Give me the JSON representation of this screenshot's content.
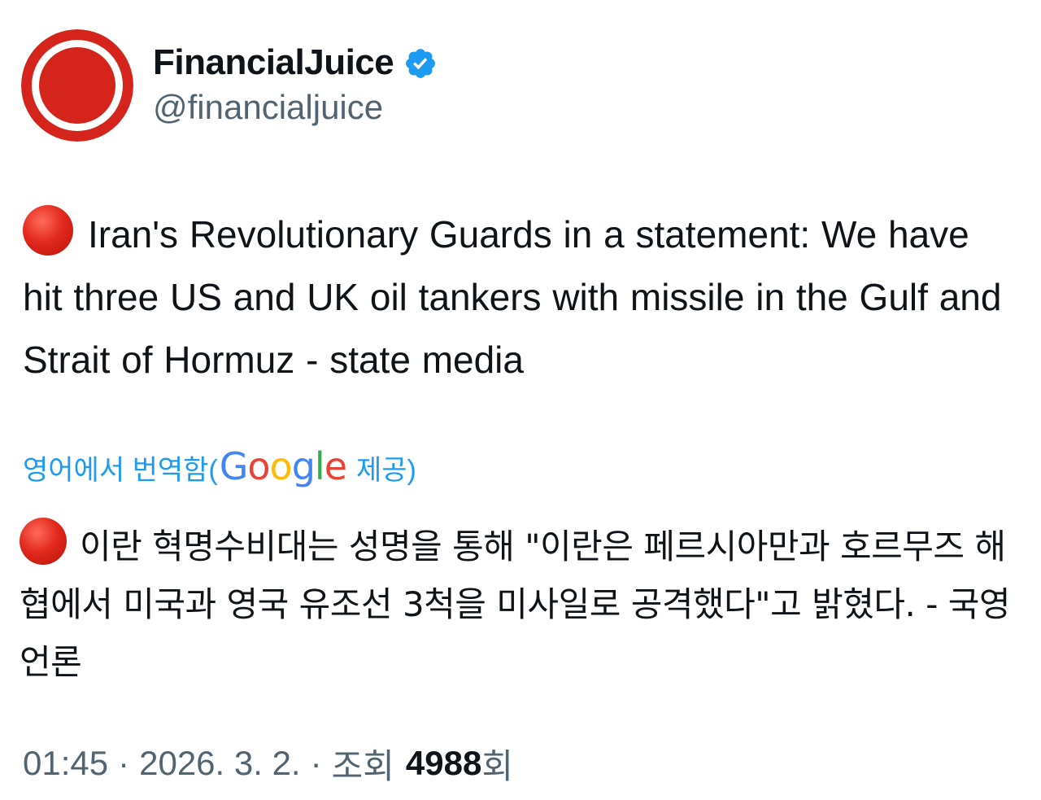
{
  "author": {
    "name": "FinancialJuice",
    "handle": "@financialjuice",
    "verified": true,
    "avatar_colors": {
      "ring": "#d4241b",
      "inner": "#d4241b",
      "gap": "#ffffff"
    }
  },
  "tweet": {
    "emoji": "red-circle-icon",
    "text": "Iran's Revolutionary Guards in a statement: We have hit three US and UK oil tankers with missile in the Gulf and Strait of Hormuz - state media"
  },
  "translation": {
    "label_prefix": "영어에서 번역함(",
    "provider_letters": [
      "G",
      "o",
      "o",
      "g",
      "l",
      "e"
    ],
    "label_suffix": "제공)",
    "text": "이란 혁명수비대는 성명을 통해 \"이란은 페르시아만과 호르무즈 해협에서 미국과 영국 유조선 3척을 미사일로 공격했다\"고 밝혔다. - 국영 언론"
  },
  "meta": {
    "time": "01:45",
    "separator": "·",
    "date": "2026. 3. 2.",
    "views_label": "조회",
    "views_count": "4988",
    "views_suffix": "회"
  },
  "colors": {
    "text": "#0f1419",
    "secondary": "#536471",
    "link": "#1d9bf0",
    "verified": "#1d9bf0",
    "brand_red": "#d4241b"
  }
}
